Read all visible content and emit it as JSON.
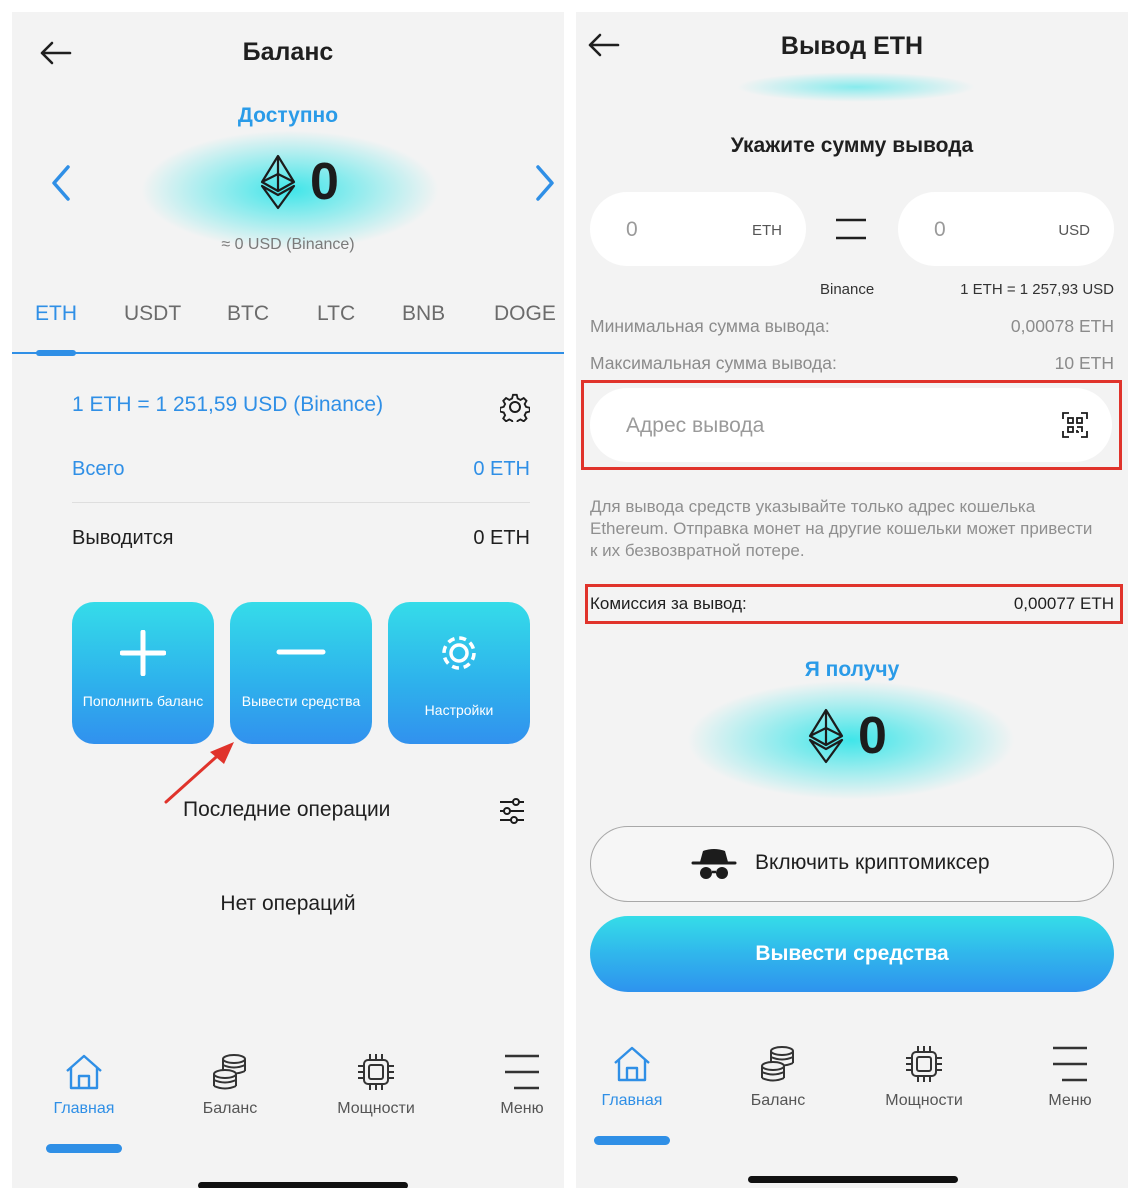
{
  "left": {
    "title": "Баланс",
    "available_label": "Доступно",
    "balance_value": "0",
    "usd_equivalent": "≈  0  USD (Binance)",
    "tabs": [
      {
        "label": "ETH",
        "active": true
      },
      {
        "label": "USDT"
      },
      {
        "label": "BTC"
      },
      {
        "label": "LTC"
      },
      {
        "label": "BNB"
      },
      {
        "label": "DOGE"
      }
    ],
    "rate": "1 ETH = 1 251,59 USD (Binance)",
    "total_label": "Всего",
    "total_value": "0 ETH",
    "withdrawing_label": "Выводится",
    "withdrawing_value": "0 ETH",
    "actions": {
      "deposit": "Пополнить баланс",
      "withdraw": "Вывести средства",
      "settings": "Настройки"
    },
    "recent_ops_title": "Последние операции",
    "no_ops": "Нет операций",
    "nav": [
      "Главная",
      "Баланс",
      "Мощности",
      "Меню"
    ],
    "arrow_color": "#e0332b"
  },
  "right": {
    "title": "Вывод ETH",
    "amount_prompt": "Укажите сумму вывода",
    "eth_input": {
      "value": "0",
      "unit": "ETH"
    },
    "usd_input": {
      "value": "0",
      "unit": "USD"
    },
    "source": "Binance",
    "rate": "1 ETH  =  1 257,93 USD",
    "min_label": "Минимальная сумма вывода:",
    "min_value": "0,00078 ETH",
    "max_label": "Максимальная сумма вывода:",
    "max_value": "10 ETH",
    "address_placeholder": "Адрес вывода",
    "note": "Для вывода средств указывайте только адрес кошелька Ethereum. Отправка монет на другие кошельки может привести к их безвозвратной потере.",
    "fee_label": "Комиссия за вывод:",
    "fee_value": "0,00077 ETH",
    "receive_label": "Я получу",
    "receive_value": "0",
    "mixer_label": "Включить криптомиксер",
    "submit_label": "Вывести средства",
    "nav": [
      "Главная",
      "Баланс",
      "Мощности",
      "Меню"
    ],
    "highlight_color": "#e0332b"
  },
  "colors": {
    "accent": "#2f8fe6",
    "cyan": "#2ce4e8",
    "background": "#f3f3f3"
  }
}
